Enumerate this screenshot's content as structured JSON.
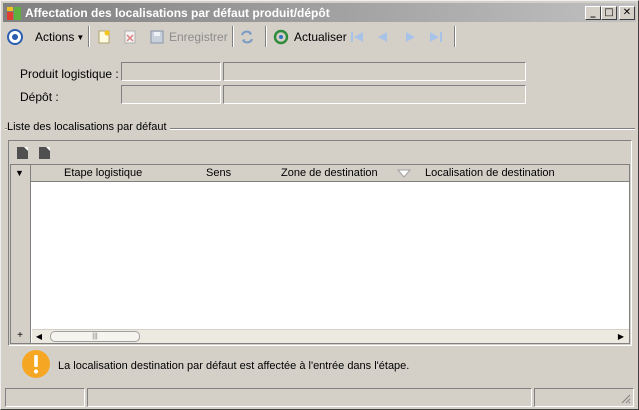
{
  "window": {
    "title": "Affectation des localisations par défaut produit/dépôt",
    "buttons": {
      "minimize": "_",
      "maximize": "□",
      "close": "✕"
    }
  },
  "toolbar": {
    "actions_label": "Actions",
    "save_label": "Enregistrer",
    "refresh_label": "Actualiser",
    "icons": [
      "menu-circle-icon",
      "new-document-icon",
      "delete-icon",
      "save-icon",
      "sync-icon",
      "refresh-icon",
      "first-icon",
      "previous-icon",
      "next-icon",
      "last-icon"
    ]
  },
  "form": {
    "produit_label": "Produit logistique :",
    "depot_label": "Dépôt :",
    "produit_code": "",
    "produit_desc": "",
    "depot_code": "",
    "depot_desc": ""
  },
  "grid": {
    "group_title": "Liste des localisations par défaut",
    "columns": [
      "Etape logistique",
      "Sens",
      "Zone de destination",
      "Localisation de destination"
    ],
    "rows": [],
    "add_row": "+"
  },
  "info": {
    "message": "La localisation destination par défaut est affectée à l'entrée dans l'étape."
  },
  "colors": {
    "titlebar_start": "#808080",
    "titlebar_end": "#c0c0c0",
    "info_icon": "#f5a623",
    "nav_disabled": "#a9c3e8"
  }
}
